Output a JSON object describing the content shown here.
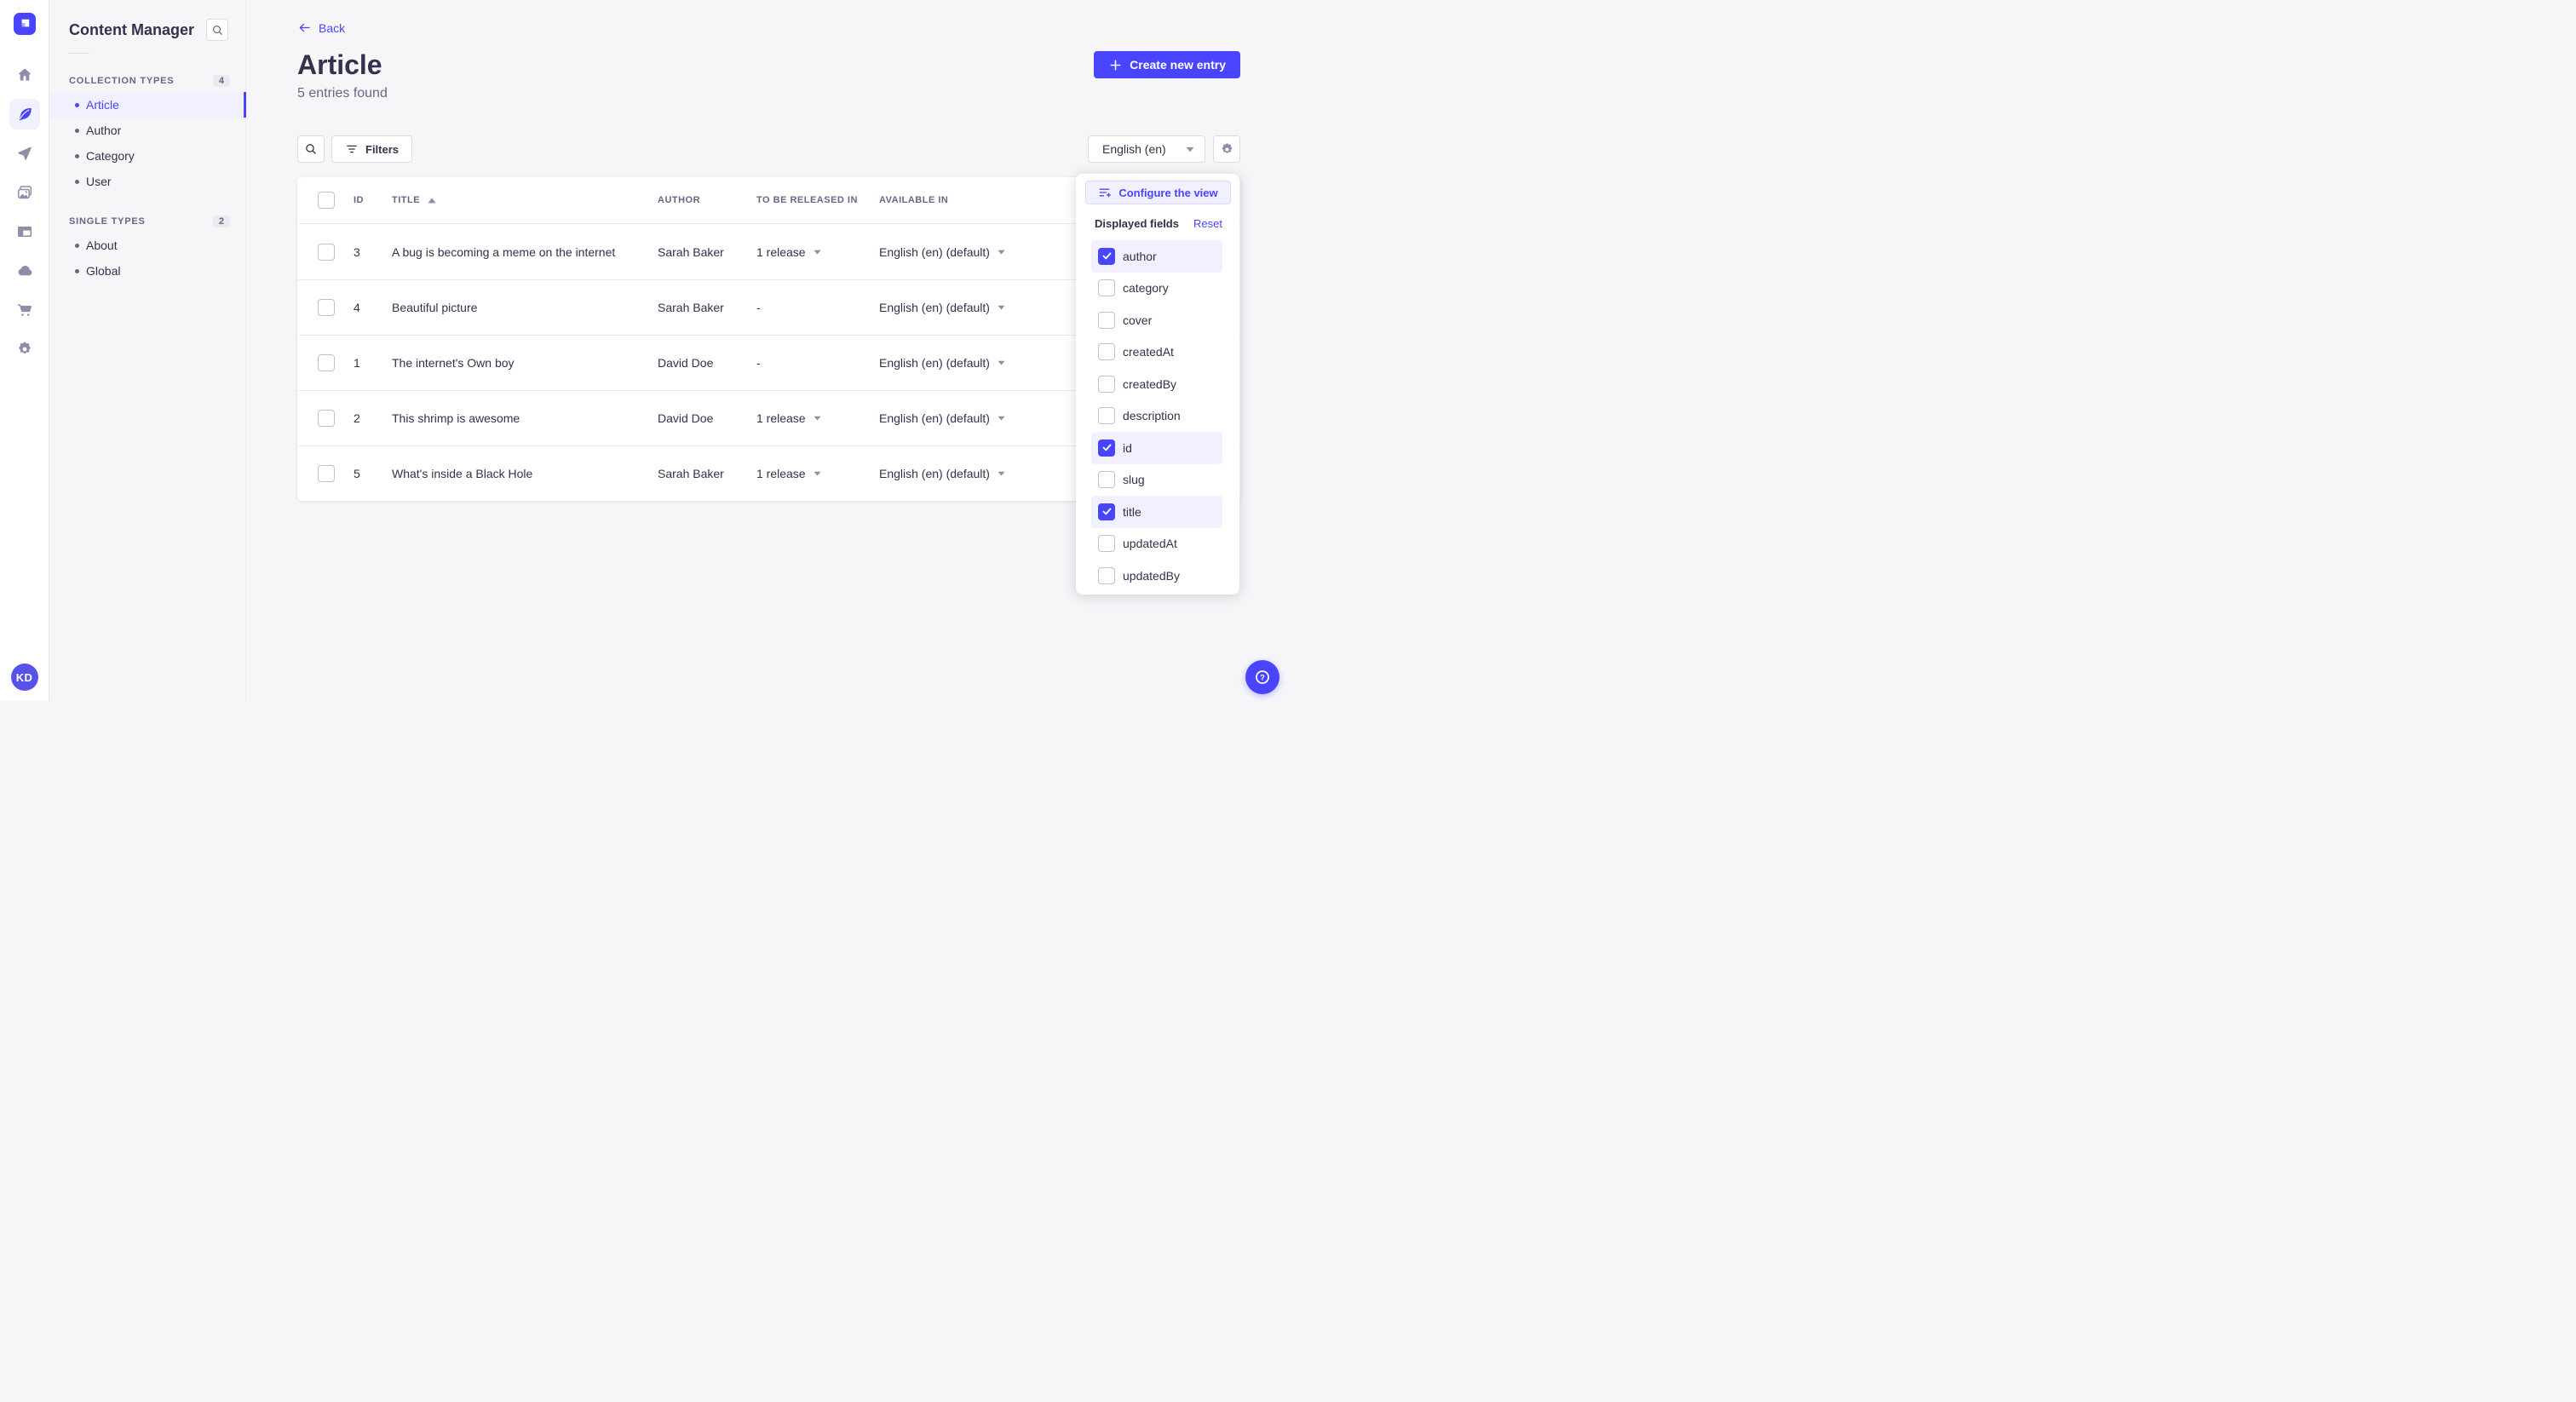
{
  "colors": {
    "primary": "#4945ff",
    "highlight": "#f0f0ff",
    "text": "#32324d",
    "muted": "#666687",
    "border": "#eaeaef"
  },
  "rail": {
    "items": [
      "home",
      "content-manager",
      "releases",
      "media-library",
      "content-type-builder",
      "deploy",
      "marketplace",
      "settings"
    ],
    "active_item": "content-manager",
    "avatar_initials": "KD"
  },
  "subnav": {
    "title": "Content Manager",
    "sections": [
      {
        "label": "COLLECTION TYPES",
        "count": "4",
        "items": [
          {
            "label": "Article",
            "active": true
          },
          {
            "label": "Author",
            "active": false
          },
          {
            "label": "Category",
            "active": false
          },
          {
            "label": "User",
            "active": false
          }
        ]
      },
      {
        "label": "SINGLE TYPES",
        "count": "2",
        "items": [
          {
            "label": "About",
            "active": false
          },
          {
            "label": "Global",
            "active": false
          }
        ]
      }
    ]
  },
  "header": {
    "back_label": "Back",
    "title": "Article",
    "subtitle": "5 entries found",
    "create_button_label": "Create new entry"
  },
  "toolbar": {
    "filters_label": "Filters",
    "locale_value": "English (en)"
  },
  "table": {
    "columns": [
      "ID",
      "TITLE",
      "AUTHOR",
      "TO BE RELEASED IN",
      "AVAILABLE IN"
    ],
    "sorted_column": "TITLE",
    "sort_direction": "asc",
    "rows": [
      {
        "id": "3",
        "title": "A bug is becoming a meme on the internet",
        "author": "Sarah Baker",
        "to_be_released_in": "1 release",
        "available_in": "English (en) (default)"
      },
      {
        "id": "4",
        "title": "Beautiful picture",
        "author": "Sarah Baker",
        "to_be_released_in": "-",
        "available_in": "English (en) (default)"
      },
      {
        "id": "1",
        "title": "The internet's Own boy",
        "author": "David Doe",
        "to_be_released_in": "-",
        "available_in": "English (en) (default)"
      },
      {
        "id": "2",
        "title": "This shrimp is awesome",
        "author": "David Doe",
        "to_be_released_in": "1 release",
        "available_in": "English (en) (default)"
      },
      {
        "id": "5",
        "title": "What's inside a Black Hole",
        "author": "Sarah Baker",
        "to_be_released_in": "1 release",
        "available_in": "English (en) (default)"
      }
    ]
  },
  "popover": {
    "configure_label": "Configure the view",
    "displayed_fields_label": "Displayed fields",
    "reset_label": "Reset",
    "fields": [
      {
        "label": "author",
        "checked": true
      },
      {
        "label": "category",
        "checked": false
      },
      {
        "label": "cover",
        "checked": false
      },
      {
        "label": "createdAt",
        "checked": false
      },
      {
        "label": "createdBy",
        "checked": false
      },
      {
        "label": "description",
        "checked": false
      },
      {
        "label": "id",
        "checked": true
      },
      {
        "label": "slug",
        "checked": false
      },
      {
        "label": "title",
        "checked": true
      },
      {
        "label": "updatedAt",
        "checked": false
      },
      {
        "label": "updatedBy",
        "checked": false
      }
    ]
  },
  "help": {
    "glyph": "?"
  }
}
